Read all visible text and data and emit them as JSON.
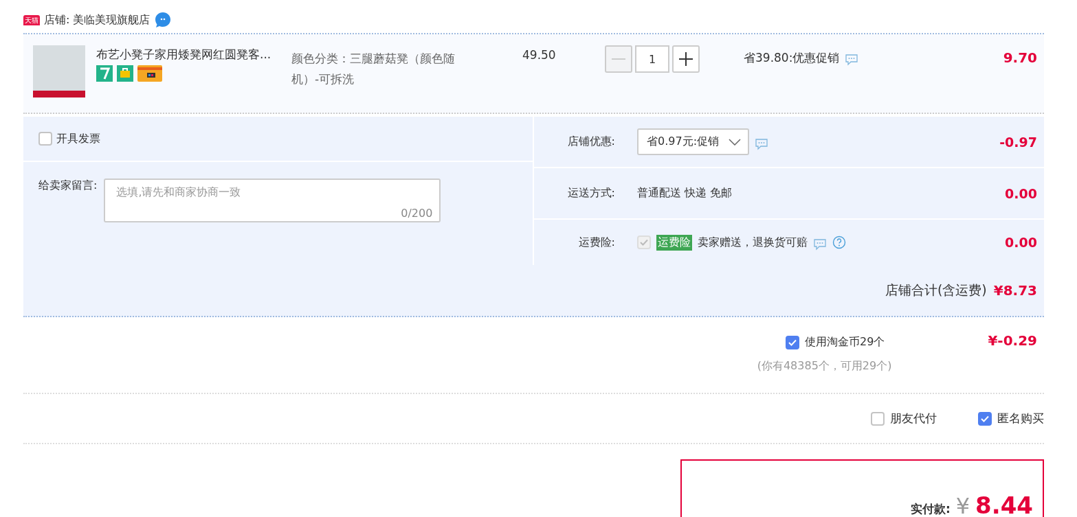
{
  "store": {
    "badge": "天猫",
    "label": "店铺: 美临美现旗舰店"
  },
  "item": {
    "title": "布艺小凳子家用矮凳网红圆凳客...",
    "sku": "颜色分类：三腿蘑菇凳（颜色随机）-可拆洗",
    "price": "49.50",
    "quantity": {
      "value": "1",
      "minus_disabled": true
    },
    "promo": "省39.80:优惠促销",
    "subtotal": "9.70"
  },
  "invoice": {
    "label": "开具发票",
    "checked": false
  },
  "message": {
    "label": "给卖家留言:",
    "placeholder": "选填,请先和商家协商一致",
    "counter": "0/200"
  },
  "fees": [
    {
      "kind": "select",
      "label": "店铺优惠:",
      "value": "省0.97元:促销",
      "amount": "-0.97"
    },
    {
      "kind": "text",
      "label": "运送方式:",
      "value": "普通配送 快递 免邮",
      "amount": "0.00"
    },
    {
      "kind": "insurance",
      "label": "运费险:",
      "checked": true,
      "disabled": true,
      "tag": "运费险",
      "value": "卖家赠送，退换货可赔",
      "amount": "0.00"
    }
  ],
  "total": {
    "label": "店铺合计(含运费)",
    "amount": "¥8.73"
  },
  "coins": {
    "checked": true,
    "label": "使用淘金币29个",
    "note": "(你有48385个，可用29个)",
    "amount": "¥-0.29"
  },
  "options": [
    {
      "label": "朋友代付",
      "checked": false
    },
    {
      "label": "匿名购买",
      "checked": true
    }
  ],
  "pay": {
    "label": "实付款:",
    "currency": "¥",
    "amount": "8.44"
  }
}
